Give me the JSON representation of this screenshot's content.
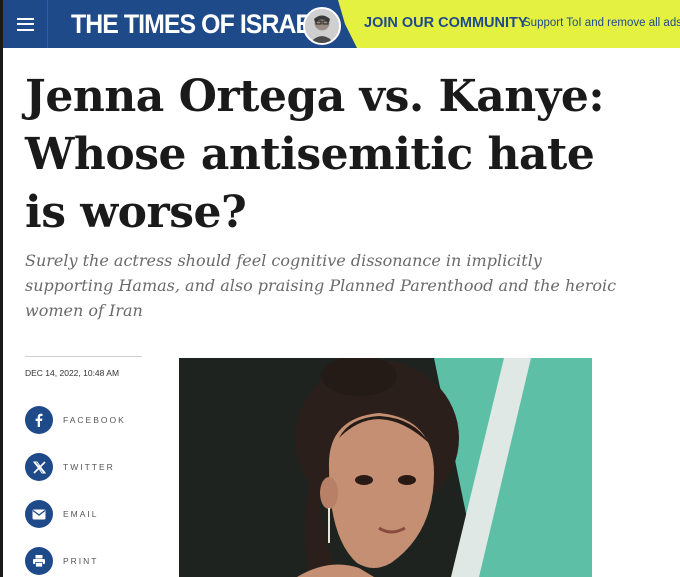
{
  "header": {
    "logo": "THE TIMES OF ISRAEL",
    "promo_title": "JOIN OUR COMMUNITY",
    "promo_subtitle": "Support ToI and remove all ads"
  },
  "article": {
    "headline": "Jenna Ortega vs. Kanye: Whose antisemitic hate is worse?",
    "subheadline": "Surely the actress should feel cognitive dissonance in implicitly supporting Hamas, and also praising Planned Parenthood and the heroic women of Iran",
    "date": "DEC 14, 2022, 10:48 AM"
  },
  "share": [
    {
      "label": "FACEBOOK",
      "icon": "facebook-icon"
    },
    {
      "label": "TWITTER",
      "icon": "twitter-icon"
    },
    {
      "label": "EMAIL",
      "icon": "email-icon"
    },
    {
      "label": "PRINT",
      "icon": "print-icon"
    }
  ],
  "colors": {
    "brand_blue": "#1f4a8a",
    "promo_yellow": "#e4f141",
    "photo_teal": "#5dbfa6"
  }
}
